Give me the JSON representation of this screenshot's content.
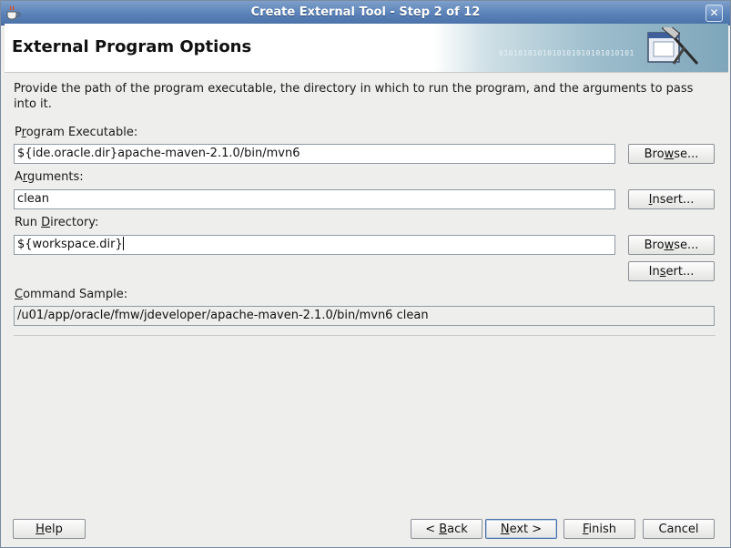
{
  "window": {
    "title": "Create External Tool - Step 2 of 12",
    "close_glyph": "✕"
  },
  "banner": {
    "title": "External Program Options",
    "binary_text": "0101010101010101010101010101"
  },
  "description": "Provide the path of the program executable, the directory in which to run the program, and the arguments to pass into it.",
  "program_executable": {
    "label_pre": "P",
    "label_accel": "r",
    "label_post": "ogram Executable:",
    "value": "${ide.oracle.dir}apache-maven-2.1.0/bin/mvn6",
    "browse_pre": "Bro",
    "browse_accel": "w",
    "browse_post": "se..."
  },
  "arguments": {
    "label_pre": "A",
    "label_accel": "r",
    "label_post": "guments:",
    "value": "clean",
    "insert_pre": "",
    "insert_accel": "I",
    "insert_post": "nsert..."
  },
  "run_directory": {
    "label_pre": "Run ",
    "label_accel": "D",
    "label_post": "irectory:",
    "value": "${workspace.dir}",
    "browse_pre": "Bro",
    "browse_accel": "w",
    "browse_post": "se...",
    "insert_pre": "In",
    "insert_accel": "s",
    "insert_post": "ert..."
  },
  "command_sample": {
    "label_pre": "",
    "label_accel": "C",
    "label_post": "ommand Sample:",
    "value": "/u01/app/oracle/fmw/jdeveloper/apache-maven-2.1.0/bin/mvn6 clean"
  },
  "footer": {
    "help_pre": "",
    "help_accel": "H",
    "help_post": "elp",
    "back_pre": "< ",
    "back_accel": "B",
    "back_post": "ack",
    "next_pre": "",
    "next_accel": "N",
    "next_post": "ext >",
    "finish_pre": "",
    "finish_accel": "F",
    "finish_post": "inish",
    "cancel": "Cancel"
  },
  "colors": {
    "titlebar": "#5a82b8",
    "dialog_bg": "#eeeeec",
    "default_button_border": "#4a6fa5"
  }
}
